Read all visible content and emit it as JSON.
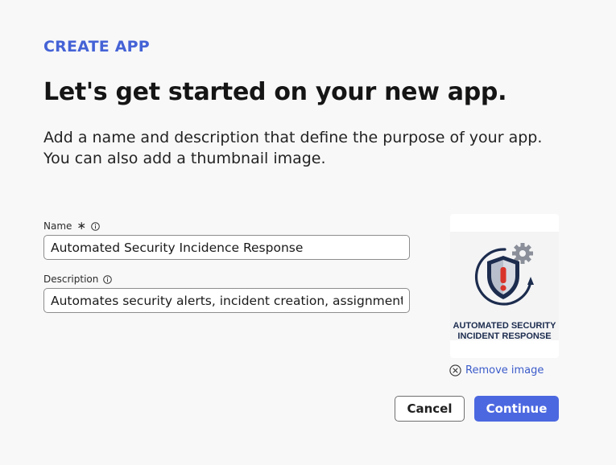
{
  "header": {
    "eyebrow": "CREATE APP",
    "title": "Let's get started on your new app.",
    "subtitle_line1": "Add a name and description that define the purpose of your app.",
    "subtitle_line2": "You can also add a thumbnail image."
  },
  "form": {
    "name": {
      "label": "Name",
      "required_mark": "∗",
      "value": "Automated Security Incidence Response"
    },
    "description": {
      "label": "Description",
      "value": "Automates security alerts, incident creation, assignment, a"
    }
  },
  "thumbnail": {
    "caption_line1": "AUTOMATED SECURITY",
    "caption_line2": "INCIDENT RESPONSE",
    "remove_label": "Remove image",
    "icon": "shield-alert-gear-icon"
  },
  "actions": {
    "cancel_label": "Cancel",
    "continue_label": "Continue"
  },
  "colors": {
    "accent": "#4c68e0",
    "eyebrow": "#4563d6",
    "link": "#3b5bc9",
    "shield_navy": "#1c2c4e",
    "alert_red": "#d9342b",
    "gear_gray": "#8a8f99"
  }
}
